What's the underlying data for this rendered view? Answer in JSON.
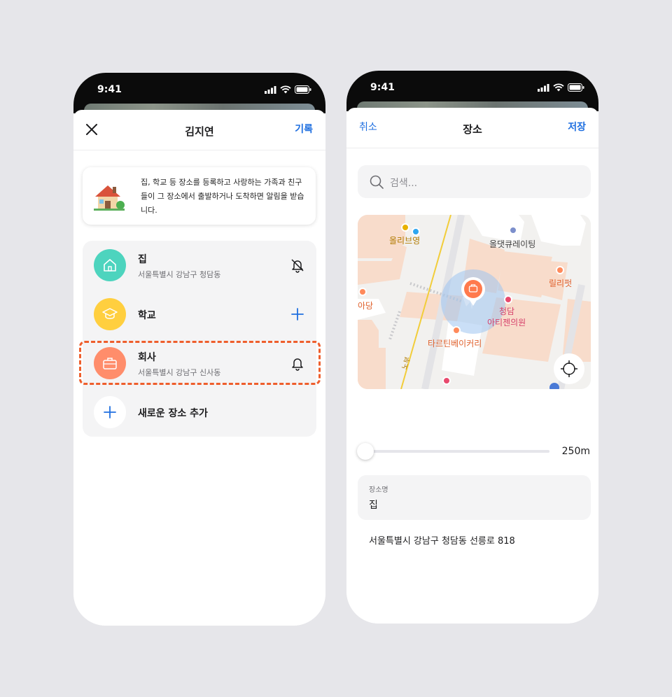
{
  "colors": {
    "accent": "#1f6fe0",
    "highlight": "#ee5e2c",
    "home": "#4dd4be",
    "school": "#ffcf3f",
    "work": "#ff8d6b"
  },
  "left": {
    "status_time": "9:41",
    "title": "김지연",
    "right_action": "기록",
    "close_icon": "close-icon",
    "info_text": "집, 학교 등 장소를 등록하고 사랑하는 가족과 친구들이 그 장소에서 출발하거나 도착하면 알림을 받습니다.",
    "places": [
      {
        "name": "집",
        "address": "서울특별시 강남구 청담동",
        "icon": "home-icon",
        "action": "bell-off-icon"
      },
      {
        "name": "학교",
        "address": "",
        "icon": "graduation-cap-icon",
        "action": "plus-icon"
      },
      {
        "name": "회사",
        "address": "서울특별시 강남구 신사동",
        "icon": "briefcase-icon",
        "action": "bell-icon"
      }
    ],
    "add_place_label": "새로운 장소 추가"
  },
  "right": {
    "status_time": "9:41",
    "title": "장소",
    "left_action": "취소",
    "right_action": "저장",
    "search_placeholder": "검색...",
    "map_labels": {
      "olive": "올리브영",
      "all_cure": "올댓큐레이팅",
      "lily": "릴리펏",
      "adang": "아당",
      "clinic_line1": "청담",
      "clinic_line2": "아티젠의원",
      "bakery": "타르틴베이커리",
      "road": "노부"
    },
    "radius_value": "250m",
    "radius_fraction": 0.0,
    "field_label": "장소명",
    "field_value": "집",
    "address": "서울특별시 강남구 청담동 선릉로 818"
  }
}
